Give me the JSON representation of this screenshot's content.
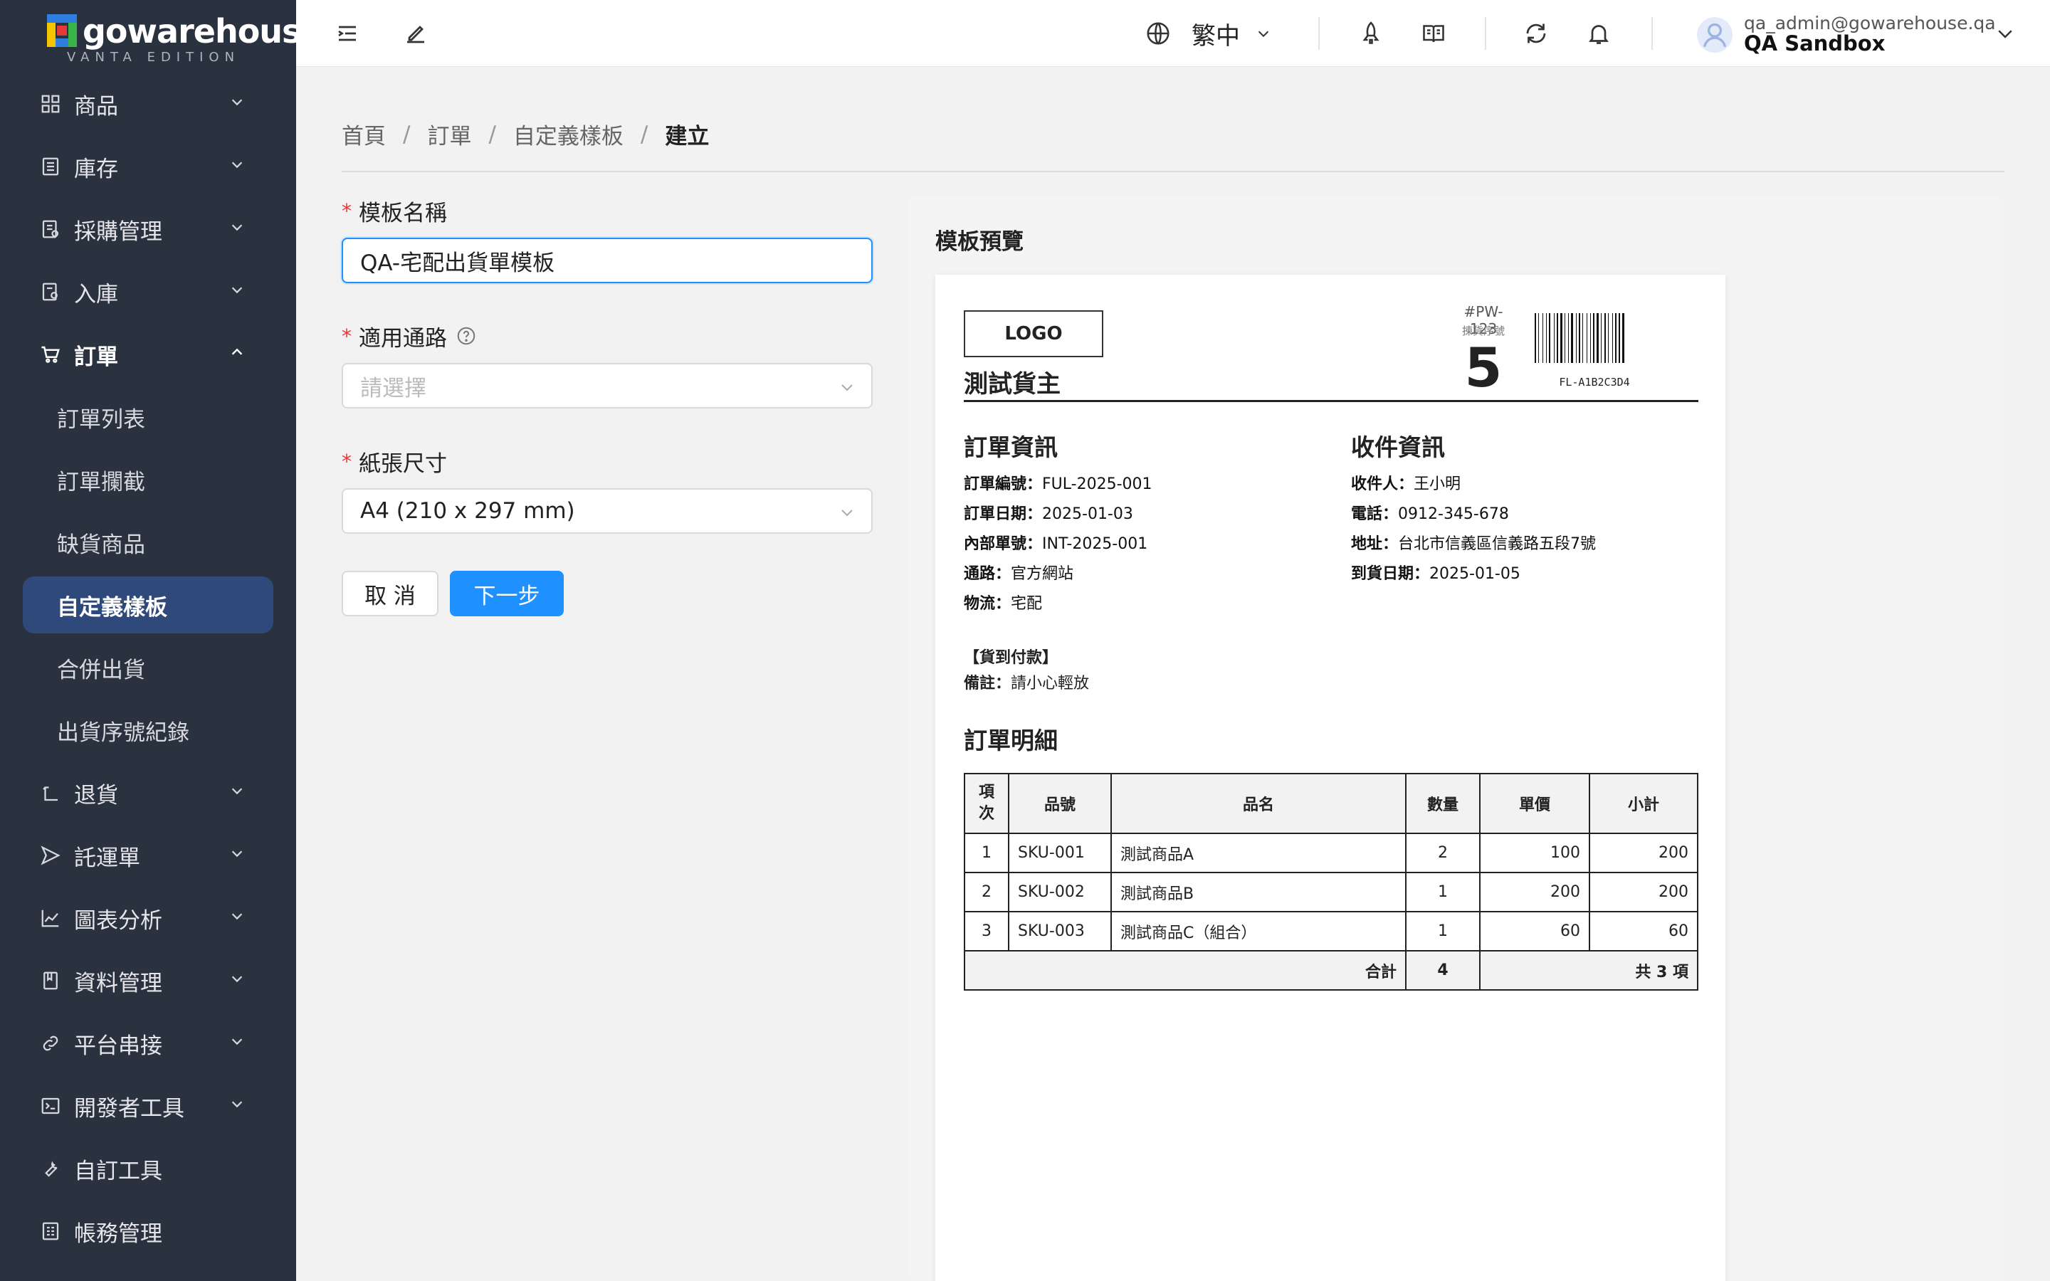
{
  "brand": {
    "name": "gowarehouse",
    "sub": "VANTA EDITION"
  },
  "sidebar": {
    "items": [
      {
        "label": "商品"
      },
      {
        "label": "庫存"
      },
      {
        "label": "採購管理"
      },
      {
        "label": "入庫"
      },
      {
        "label": "訂單"
      },
      {
        "label": "退貨"
      },
      {
        "label": "託運單"
      },
      {
        "label": "圖表分析"
      },
      {
        "label": "資料管理"
      },
      {
        "label": "平台串接"
      },
      {
        "label": "開發者工具"
      },
      {
        "label": "自訂工具"
      },
      {
        "label": "帳務管理"
      }
    ],
    "order_sub": [
      {
        "label": "訂單列表"
      },
      {
        "label": "訂單攔截"
      },
      {
        "label": "缺貨商品"
      },
      {
        "label": "自定義樣板"
      },
      {
        "label": "合併出貨"
      },
      {
        "label": "出貨序號紀錄"
      }
    ]
  },
  "header": {
    "language": "繁中",
    "user_email": "qa_admin@gowarehouse.qa",
    "user_name": "QA Sandbox"
  },
  "breadcrumb": [
    "首頁",
    "訂單",
    "自定義樣板",
    "建立"
  ],
  "form": {
    "name_label": "模板名稱",
    "name_value": "QA-宅配出貨單模板",
    "channel_label": "適用通路",
    "channel_placeholder": "請選擇",
    "paper_label": "紙張尺寸",
    "paper_value": "A4 (210 x 297 mm)",
    "cancel": "取 消",
    "next": "下一步"
  },
  "preview": {
    "title": "模板預覽",
    "logo": "LOGO",
    "owner": "測試貨主",
    "pw": "#PW-123",
    "pick_label": "揀貨序號",
    "pick_num": "5",
    "barcode": "FL-A1B2C3D4",
    "order_info_title": "訂單資訊",
    "order_info": [
      {
        "k": "訂單編號：",
        "v": "FUL-2025-001"
      },
      {
        "k": "訂單日期：",
        "v": "2025-01-03"
      },
      {
        "k": "內部單號：",
        "v": "INT-2025-001"
      },
      {
        "k": "通路：",
        "v": "官方網站"
      },
      {
        "k": "物流：",
        "v": "宅配"
      }
    ],
    "recv_info_title": "收件資訊",
    "recv_info": [
      {
        "k": "收件人：",
        "v": "王小明"
      },
      {
        "k": "電話：",
        "v": "0912-345-678"
      },
      {
        "k": "地址：",
        "v": "台北市信義區信義路五段7號"
      },
      {
        "k": "到貨日期：",
        "v": "2025-01-05"
      }
    ],
    "cod": "【貨到付款】",
    "remark_k": "備註：",
    "remark_v": "請小心輕放",
    "detail_title": "訂單明細",
    "columns": [
      "項次",
      "品號",
      "品名",
      "數量",
      "單價",
      "小計"
    ],
    "rows": [
      [
        "1",
        "SKU-001",
        "測試商品A",
        "2",
        "100",
        "200"
      ],
      [
        "2",
        "SKU-002",
        "測試商品B",
        "1",
        "200",
        "200"
      ],
      [
        "3",
        "SKU-003",
        "測試商品C（組合）",
        "1",
        "60",
        "60"
      ]
    ],
    "total_label": "合計",
    "total_qty": "4",
    "total_items": "共 3 項"
  }
}
